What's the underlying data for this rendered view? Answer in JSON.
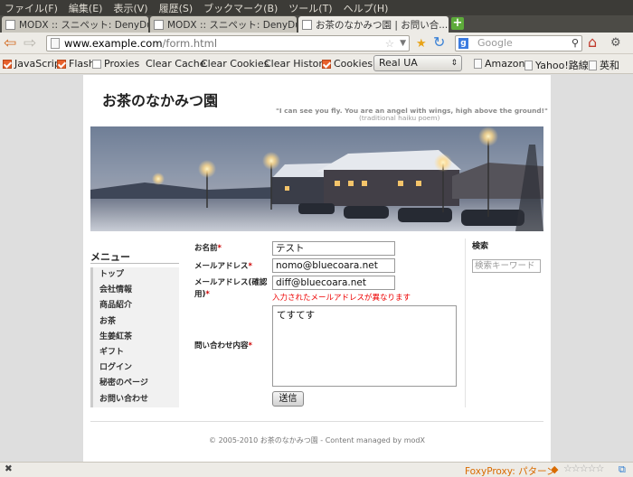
{
  "menubar": {
    "items": [
      "ファイル(F)",
      "編集(E)",
      "表示(V)",
      "履歴(S)",
      "ブックマーク(B)",
      "ツール(T)",
      "ヘルプ(H)"
    ]
  },
  "tabs": [
    {
      "label": "MODX :: スニペット: DenyDup..."
    },
    {
      "label": "MODX :: スニペット: DenyDup..."
    },
    {
      "label": "お茶のなかみつ園 | お問い合..."
    }
  ],
  "nav": {
    "url_host": "www.example.com",
    "url_path": "/form.html",
    "search_placeholder": "Google",
    "search_icon": "magnifier-icon"
  },
  "toolbar": {
    "javascript": "JavaScript",
    "flash": "Flash",
    "proxies": "Proxies",
    "clear_cache": "Clear Cache",
    "clear_cookies": "Clear Cookies",
    "clear_history": "Clear History",
    "cookies": "Cookies",
    "ua_select": "Real UA",
    "bookmarks": [
      "Amazon",
      "Yahoo!路線",
      "英和"
    ],
    "checkbox_color": "#e8612c"
  },
  "site": {
    "title": "お茶のなかみつ園",
    "quote": "\"I can see you fly. You are an angel with wings, high above the ground!\"",
    "quote_source": "(traditional haiku poem)"
  },
  "menu": {
    "heading": "メニュー",
    "items": [
      "トップ",
      "会社情報",
      "商品紹介",
      "お茶",
      "生姜紅茶",
      "ギフト",
      "ログイン",
      "秘密のページ",
      "お問い合わせ"
    ]
  },
  "form": {
    "name_label": "お名前",
    "name_value": "テスト",
    "email_label": "メールアドレス",
    "email_value": "nomo@bluecoara.net",
    "email_confirm_label_1": "メールアドレス(確認",
    "email_confirm_label_2": "用)",
    "email_confirm_value": "diff@bluecoara.net",
    "error_message": "入力されたメールアドレスが異なります",
    "inquiry_label": "問い合わせ内容",
    "inquiry_value": "てすてす",
    "required_mark": "*",
    "submit_label": "送信",
    "error_color": "#ee0000"
  },
  "search": {
    "heading": "検索",
    "placeholder": "検索キーワード"
  },
  "footer": {
    "text": "© 2005-2010 お茶のなかみつ園 - Content managed by modX"
  },
  "statusbar": {
    "foxyproxy": "FoxyProxy: パターン"
  }
}
